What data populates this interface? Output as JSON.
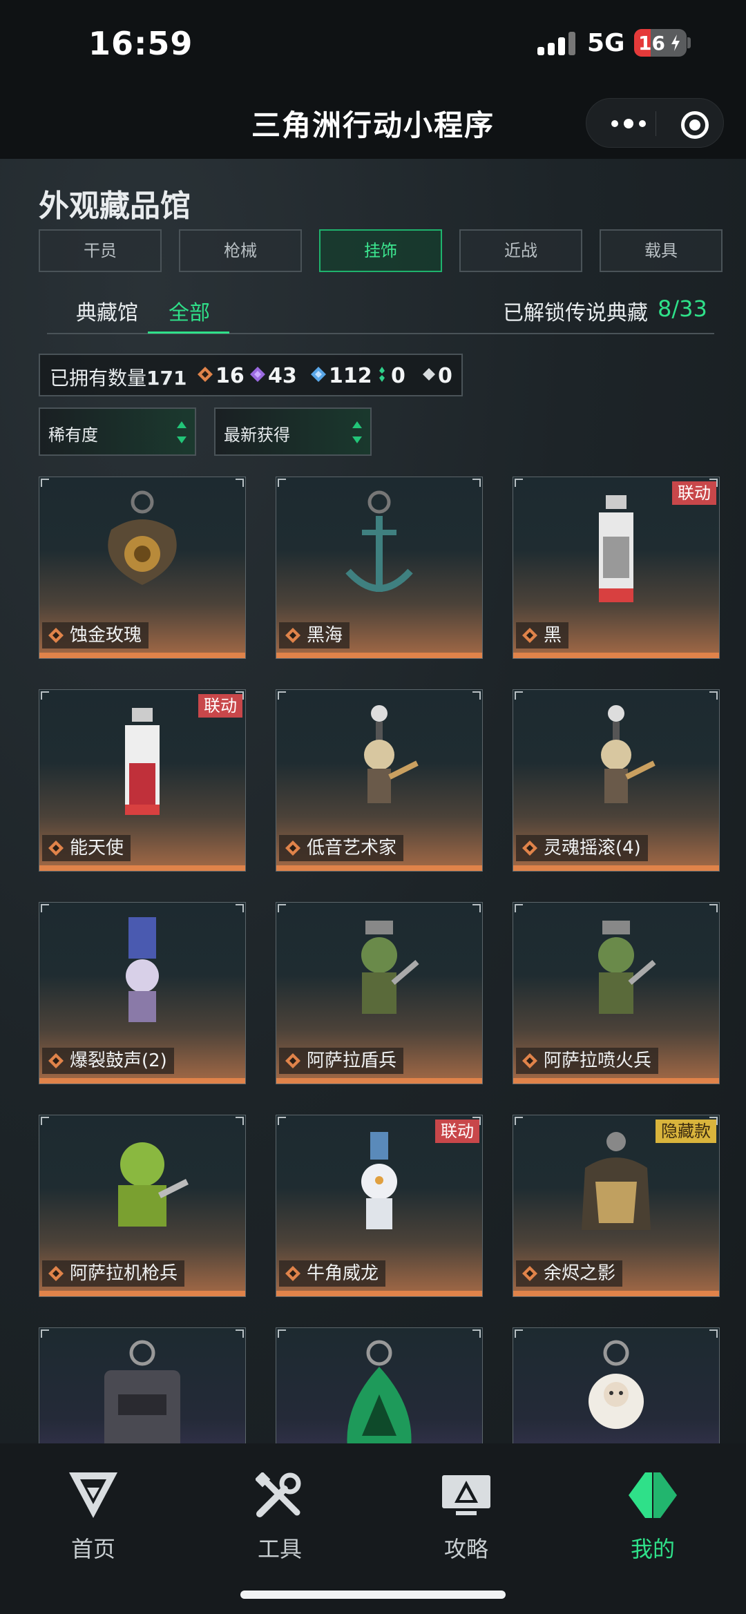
{
  "status_bar": {
    "time": "16:59",
    "network": "5G",
    "battery": "16"
  },
  "header": {
    "title": "三角洲行动小程序"
  },
  "page": {
    "title": "外观藏品馆"
  },
  "category_tabs": [
    {
      "label": "干员"
    },
    {
      "label": "枪械"
    },
    {
      "label": "挂饰"
    },
    {
      "label": "近战"
    },
    {
      "label": "载具"
    }
  ],
  "sub_tabs": [
    {
      "label": "典藏馆"
    },
    {
      "label": "全部"
    }
  ],
  "unlocked": {
    "label": "已解锁传说典藏",
    "value": "8/33"
  },
  "owned": {
    "label": "已拥有数量",
    "total": "171",
    "counts": [
      {
        "icon": "orange-diamond-icon",
        "color": "#e0834a",
        "value": "16"
      },
      {
        "icon": "purple-diamond-icon",
        "color": "#9a6ae0",
        "value": "43"
      },
      {
        "icon": "blue-diamond-icon",
        "color": "#5aa7e8",
        "value": "112"
      },
      {
        "icon": "green-diamond-icon",
        "color": "#2fd08a",
        "value": "0"
      },
      {
        "icon": "white-diamond-icon",
        "color": "#d8dcde",
        "value": "0"
      }
    ]
  },
  "filters": [
    {
      "label": "稀有度"
    },
    {
      "label": "最新获得"
    }
  ],
  "items": [
    {
      "name": "蚀金玫瑰",
      "badge": "",
      "charm": "rose"
    },
    {
      "name": "黑海",
      "badge": "",
      "charm": "anchor"
    },
    {
      "name": "黑",
      "badge": "联动",
      "charm": "card"
    },
    {
      "name": "能天使",
      "badge": "联动",
      "charm": "card-red"
    },
    {
      "name": "低音艺术家",
      "badge": "",
      "charm": "figure"
    },
    {
      "name": "灵魂摇滚(4)",
      "badge": "",
      "charm": "figure"
    },
    {
      "name": "爆裂鼓声(2)",
      "badge": "",
      "charm": "figure-purple"
    },
    {
      "name": "阿萨拉盾兵",
      "badge": "",
      "charm": "figure-green"
    },
    {
      "name": "阿萨拉喷火兵",
      "badge": "",
      "charm": "figure-green"
    },
    {
      "name": "阿萨拉机枪兵",
      "badge": "",
      "charm": "figure-lime"
    },
    {
      "name": "牛角威龙",
      "badge": "联动",
      "charm": "figure-white"
    },
    {
      "name": "余烬之影",
      "badge": "隐藏款",
      "charm": "figure-gold"
    },
    {
      "name": "",
      "badge": "",
      "charm": "case"
    },
    {
      "name": "",
      "badge": "",
      "charm": "shield"
    },
    {
      "name": "",
      "badge": "",
      "charm": "sheep"
    }
  ],
  "bottom_nav": [
    {
      "label": "首页",
      "icon": "delta-logo-icon"
    },
    {
      "label": "工具",
      "icon": "tools-icon"
    },
    {
      "label": "攻略",
      "icon": "monitor-icon"
    },
    {
      "label": "我的",
      "icon": "delta-green-icon"
    }
  ],
  "colors": {
    "accent": "#2fe089",
    "badge_red": "#c8474a",
    "badge_gold": "#d9b43c",
    "rarity_orange": "#e0834a"
  }
}
